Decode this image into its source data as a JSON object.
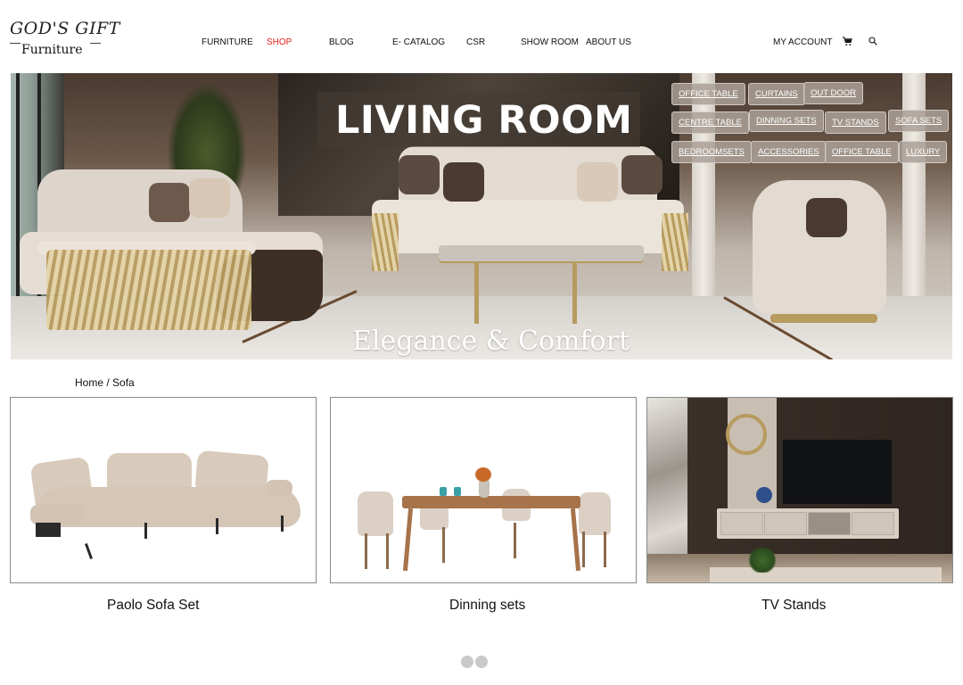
{
  "brand": {
    "logo_top": "GOD'S GIFT",
    "logo_bottom": "Furniture"
  },
  "nav": {
    "items": [
      {
        "label": "FURNITURE",
        "active": false
      },
      {
        "label": "SHOP",
        "active": true
      },
      {
        "label": "BLOG",
        "active": false
      },
      {
        "label": "E- CATALOG",
        "active": false
      },
      {
        "label": "CSR",
        "active": false
      },
      {
        "label": "SHOW ROOM",
        "active": false
      },
      {
        "label": "ABOUT US",
        "active": false
      }
    ],
    "account_label": "MY ACCOUNT",
    "cart_icon": "cart-icon",
    "search_icon": "search-icon",
    "active_color": "#e3221c"
  },
  "hero": {
    "title": "LIVING ROOM",
    "subtitle": "Elegance & Comfort",
    "categories": [
      "OFFICE TABLE",
      "CURTAINS",
      "OUT DOOR",
      "CENTRE TABLE",
      "DINNING SETS",
      "TV STANDS",
      "SOFA SETS",
      "BEDROOMSETS",
      "ACCESSORIES",
      "OFFICE TABLE",
      "LUXURY"
    ]
  },
  "breadcrumb": {
    "home": "Home",
    "separator": "/",
    "current": "Sofa"
  },
  "products": [
    {
      "title": "Paolo Sofa Set"
    },
    {
      "title": "Dinning sets"
    },
    {
      "title": "TV Stands"
    }
  ],
  "carousel": {
    "dot_count": 2,
    "dot_color": "#c9c9c9"
  }
}
